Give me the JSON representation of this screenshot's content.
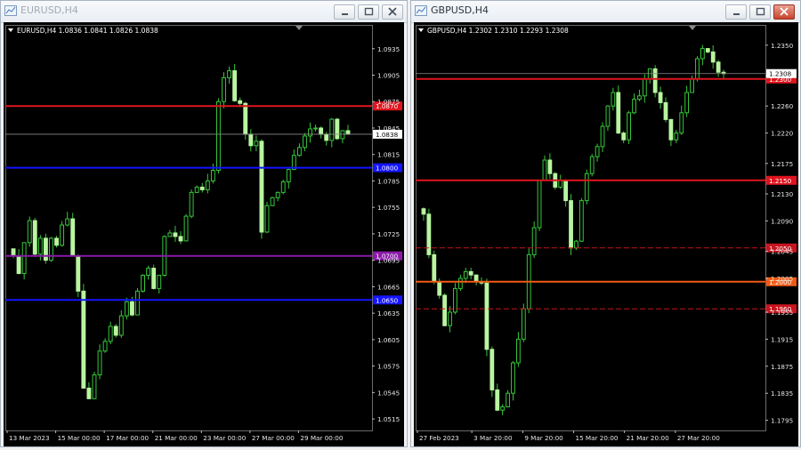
{
  "windows": [
    {
      "id": "eurusd",
      "title": "EURUSD,H4",
      "header": "EURUSD,H4  1.0836 1.0841 1.0826 1.0838",
      "y_range": [
        1.0502,
        1.0962
      ],
      "y_ticks": [
        "1.0935",
        "1.0905",
        "1.0875",
        "1.0845",
        "1.0815",
        "1.0785",
        "1.0755",
        "1.0725",
        "1.0695",
        "1.0665",
        "1.0635",
        "1.0605",
        "1.0575",
        "1.0545",
        "1.0515"
      ],
      "x_ticks": [
        "13 Mar 2023",
        "15 Mar 00:00",
        "17 Mar 00:00",
        "21 Mar 00:00",
        "23 Mar 00:00",
        "27 Mar 00:00",
        "29 Mar 00:00"
      ],
      "current_price": "1.0838",
      "current_price_value": 1.0838,
      "levels": [
        {
          "value": 1.087,
          "label": "1.0870",
          "color": "#e0141e",
          "style": "solid"
        },
        {
          "value": 1.08,
          "label": "1.0800",
          "color": "#1414ff",
          "style": "solid"
        },
        {
          "value": 1.07,
          "label": "1.0700",
          "color": "#8a1aa8",
          "style": "solid"
        },
        {
          "value": 1.065,
          "label": "1.0650",
          "color": "#1414ff",
          "style": "solid"
        }
      ],
      "closes": [
        1.07,
        1.068,
        1.0715,
        1.074,
        1.0702,
        1.072,
        1.0695,
        1.072,
        1.0712,
        1.0735,
        1.0742,
        1.07,
        1.066,
        1.055,
        1.0538,
        1.0565,
        1.0592,
        1.0603,
        1.062,
        1.061,
        1.0632,
        1.0648,
        1.0633,
        1.066,
        1.0678,
        1.0686,
        1.0663,
        1.0678,
        1.0722,
        1.0726,
        1.0722,
        1.0717,
        1.0745,
        1.0772,
        1.0778,
        1.0775,
        1.0785,
        1.0797,
        1.0875,
        1.0902,
        1.091,
        1.0876,
        1.0873,
        1.0838,
        1.0825,
        1.083,
        1.0727,
        1.0757,
        1.0766,
        1.0772,
        1.0784,
        1.0798,
        1.0814,
        1.0823,
        1.0836,
        1.0844,
        1.0845,
        1.0838,
        1.0831,
        1.0855,
        1.0833,
        1.0842,
        1.0838
      ]
    },
    {
      "id": "gbpusd",
      "title": "GBPUSD,H4",
      "header": "GBPUSD,H4  1.2302 1.2310 1.2293 1.2308",
      "y_range": [
        1.178,
        1.238
      ],
      "y_ticks": [
        "1.2350",
        "1.2305",
        "1.2260",
        "1.2220",
        "1.2175",
        "1.2130",
        "1.2090",
        "1.2045",
        "1.2005",
        "1.1955",
        "1.1915",
        "1.1875",
        "1.1835",
        "1.1795"
      ],
      "x_ticks": [
        "27 Feb 2023",
        "3 Mar 20:00",
        "9 Mar 20:00",
        "15 Mar 20:00",
        "21 Mar 20:00",
        "27 Mar 20:00"
      ],
      "current_price": "1.2308",
      "current_price_value": 1.2308,
      "levels": [
        {
          "value": 1.23,
          "label": "1.2300",
          "color": "#e0141e",
          "style": "solid"
        },
        {
          "value": 1.215,
          "label": "1.2150",
          "color": "#e0141e",
          "style": "solid"
        },
        {
          "value": 1.205,
          "label": "1.2050",
          "color": "#c8141e",
          "style": "dashed"
        },
        {
          "value": 1.2,
          "label": "1.2000",
          "color": "#f05a14",
          "style": "solid"
        },
        {
          "value": 1.196,
          "label": "1.1960",
          "color": "#c8141e",
          "style": "dashed"
        }
      ],
      "closes": [
        1.21,
        1.204,
        1.2,
        1.198,
        1.1935,
        1.1955,
        1.199,
        1.2005,
        1.2015,
        1.201,
        1.2,
        1.1998,
        1.19,
        1.184,
        1.181,
        1.1815,
        1.1835,
        1.188,
        1.1915,
        1.196,
        1.204,
        1.208,
        1.215,
        1.218,
        1.216,
        1.214,
        1.215,
        1.212,
        1.205,
        1.206,
        1.212,
        1.216,
        1.2185,
        1.22,
        1.223,
        1.226,
        1.228,
        1.222,
        1.221,
        1.225,
        1.227,
        1.2275,
        1.23,
        1.2315,
        1.228,
        1.2265,
        1.224,
        1.221,
        1.222,
        1.225,
        1.228,
        1.23,
        1.233,
        1.2345,
        1.234,
        1.2325,
        1.231,
        1.2308
      ]
    }
  ]
}
